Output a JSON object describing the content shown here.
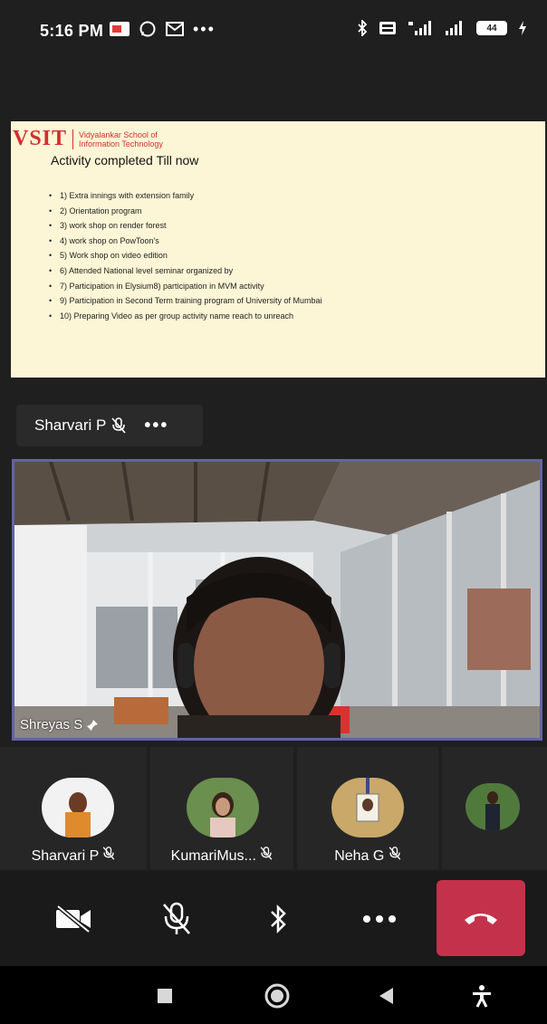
{
  "status_bar": {
    "time": "5:16 PM",
    "battery": "44",
    "icons_left": [
      "notification-flag-icon",
      "whatsapp-icon",
      "gmail-icon",
      "more-dots-icon"
    ],
    "icons_right": [
      "bluetooth-icon",
      "volte-icon",
      "signal-4g-icon",
      "signal-icon",
      "battery-icon",
      "charging-icon"
    ]
  },
  "slide": {
    "logo_text": "VSIT",
    "logo_sub_line1": "Vidyalankar School of",
    "logo_sub_line2": "Information Technology",
    "title": "Activity completed Till now",
    "items": [
      "1) Extra innings with extension family",
      "2) Orientation program",
      "3) work shop on render forest",
      "4) work shop on PowToon's",
      "5) Work shop on video edition",
      "6) Attended National level seminar organized by",
      "7) Participation in Elysium8) participation in MVM activity",
      "9) Participation in Second Term training program of University of Mumbai",
      "10) Preparing Video as per group activity name reach to unreach"
    ]
  },
  "presenter": {
    "name": "Sharvari P"
  },
  "main_video": {
    "name": "Shreyas S"
  },
  "participants": [
    {
      "name": "Sharvari P",
      "avatar_color": "#e08a2e"
    },
    {
      "name": "KumariMus...",
      "avatar_color": "#6b8f4e"
    },
    {
      "name": "Neha G",
      "avatar_color": "#c9a86a"
    },
    {
      "name": "",
      "avatar_color": "#4f7a3c"
    }
  ],
  "colors": {
    "accent": "#6264a7",
    "end_call": "#c4314b",
    "background": "#1f1f1f"
  }
}
